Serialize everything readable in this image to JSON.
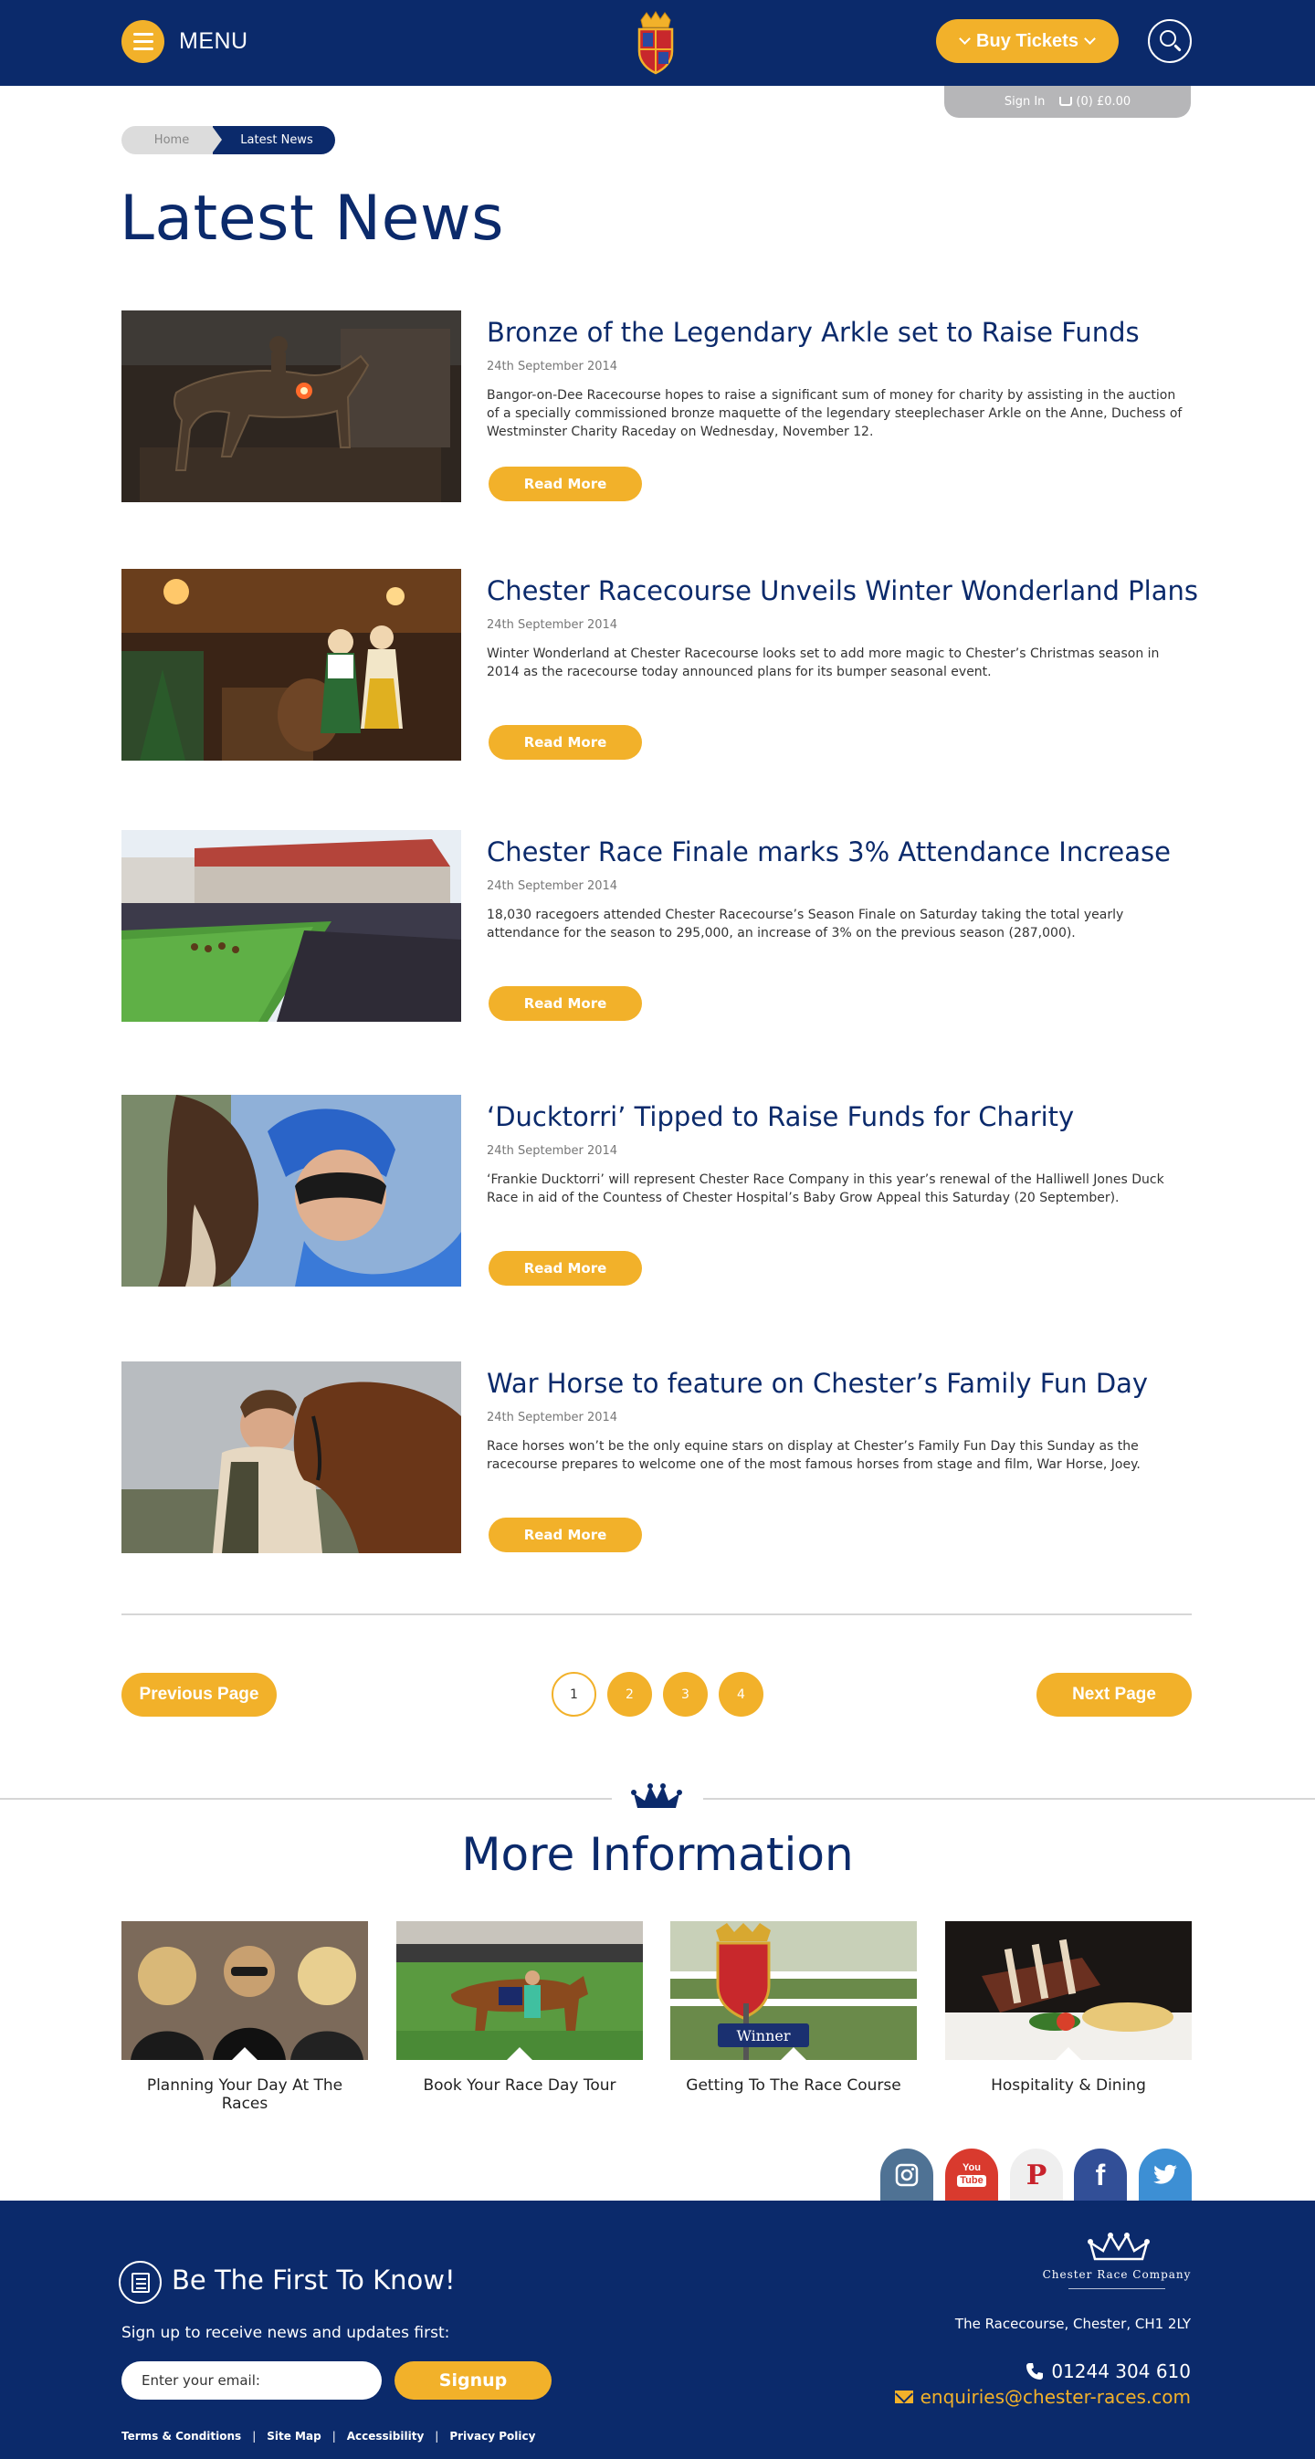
{
  "header": {
    "menu_label": "MENU",
    "buy_label": "Buy Tickets",
    "signin_label": "Sign In",
    "cart_label": "(0) £0.00"
  },
  "breadcrumb": {
    "home": "Home",
    "current": "Latest News"
  },
  "page_title": "Latest News",
  "news": [
    {
      "title": "Bronze of the Legendary Arkle set to Raise Funds",
      "date": "24th September 2014",
      "excerpt": "Bangor-on-Dee Racecourse hopes to raise a significant sum of money for charity by assisting in the auction of a specially commissioned bronze maquette of the legendary steeplechaser Arkle on the Anne, Duchess of Westminster Charity Raceday on Wednesday, November 12.",
      "button": "Read More"
    },
    {
      "title": "Chester Racecourse Unveils Winter Wonderland Plans",
      "date": "24th September 2014",
      "excerpt": "Winter Wonderland at Chester Racecourse looks set to add more magic to Chester’s Christmas season in 2014 as the racecourse today announced plans for its bumper seasonal event.",
      "button": "Read More"
    },
    {
      "title": "Chester Race Finale marks 3% Attendance Increase",
      "date": "24th September 2014",
      "excerpt": "18,030 racegoers attended Chester Racecourse’s Season Finale on Saturday taking the total yearly attendance for the season to 295,000, an increase of 3% on the previous season (287,000).",
      "button": "Read More"
    },
    {
      "title": "‘Ducktorri’ Tipped to Raise Funds for Charity",
      "date": "24th September 2014",
      "excerpt": "‘Frankie Ducktorri’ will represent Chester Race Company in this year’s renewal of the Halliwell Jones Duck Race in aid of the Countess of Chester Hospital’s Baby Grow Appeal this Saturday (20 September).",
      "button": "Read More"
    },
    {
      "title": "War Horse to feature on Chester’s Family Fun Day",
      "date": "24th September 2014",
      "excerpt": "Race horses won’t be the only equine stars on display at Chester’s Family Fun Day this Sunday as the racecourse prepares to welcome one of the most famous horses from stage and film, War Horse, Joey.",
      "button": "Read More"
    }
  ],
  "pagination": {
    "prev": "Previous Page",
    "next": "Next Page",
    "pages": [
      "1",
      "2",
      "3",
      "4"
    ],
    "current": "1"
  },
  "more_info": {
    "title": "More Information",
    "cards": [
      {
        "label": "Planning Your Day At The Races"
      },
      {
        "label": "Book Your Race Day Tour"
      },
      {
        "label": "Getting To The Race Course",
        "sign_text": "Winner"
      },
      {
        "label": "Hospitality & Dining"
      }
    ]
  },
  "social": [
    {
      "name": "instagram",
      "color": "#4f7294"
    },
    {
      "name": "youtube",
      "color": "#d93a2e",
      "text_top": "You",
      "text_bottom": "Tube"
    },
    {
      "name": "pinterest",
      "color": "#efefef",
      "text": "P"
    },
    {
      "name": "facebook",
      "color": "#324f97",
      "text": "f"
    },
    {
      "name": "twitter",
      "color": "#3d8fd4"
    }
  ],
  "footer": {
    "newsletter_title": "Be The First To Know!",
    "newsletter_sub": "Sign up to receive news and updates first:",
    "email_placeholder": "Enter your email:",
    "signup": "Signup",
    "links": [
      "Terms & Conditions",
      "Site Map",
      "Accessibility",
      "Privacy Policy"
    ],
    "company": "Chester Race Company",
    "address": "The Racecourse, Chester, CH1 2LY",
    "phone": "01244 304 610",
    "email": "enquiries@chester-races.com"
  },
  "colors": {
    "navy": "#0b2a6b",
    "gold": "#f2b12a",
    "grey": "#b6b6b8"
  }
}
